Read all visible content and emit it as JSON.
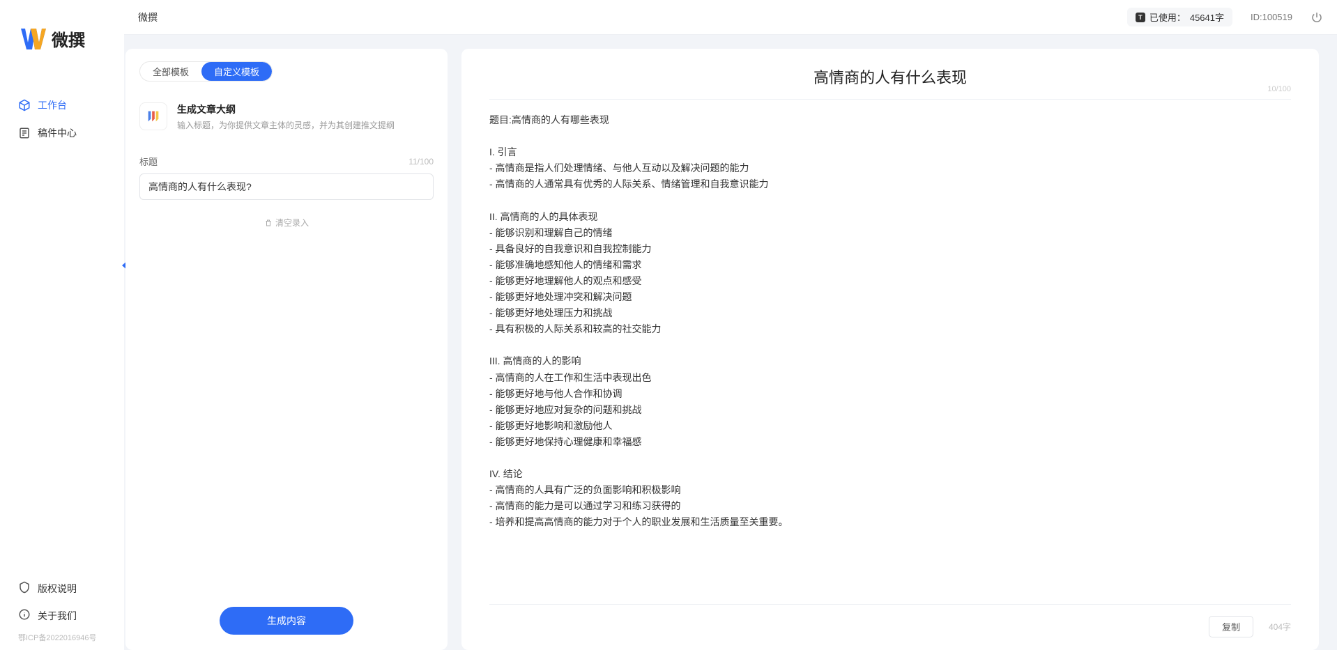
{
  "app": {
    "logo_text": "微撰",
    "title": "微撰"
  },
  "sidebar": {
    "nav": [
      {
        "label": "工作台",
        "active": true
      },
      {
        "label": "稿件中心",
        "active": false
      }
    ],
    "bottom": [
      {
        "label": "版权说明"
      },
      {
        "label": "关于我们"
      }
    ],
    "icp": "鄂ICP备2022016946号"
  },
  "topbar": {
    "usage_label": "已使用：",
    "usage_value": "45641字",
    "user_id": "ID:100519"
  },
  "left_panel": {
    "tabs": [
      {
        "label": "全部模板",
        "active": false
      },
      {
        "label": "自定义模板",
        "active": true
      }
    ],
    "template": {
      "name": "生成文章大纲",
      "desc": "输入标题，为你提供文章主体的灵感，并为其创建推文提纲"
    },
    "field": {
      "label": "标题",
      "count": "11/100",
      "value": "高情商的人有什么表现?"
    },
    "clear_link": "清空录入",
    "generate_btn": "生成内容"
  },
  "right_panel": {
    "title": "高情商的人有什么表现",
    "title_count": "10/100",
    "body": "题目:高情商的人有哪些表现\n\nI. 引言\n- 高情商是指人们处理情绪、与他人互动以及解决问题的能力\n- 高情商的人通常具有优秀的人际关系、情绪管理和自我意识能力\n\nII. 高情商的人的具体表现\n- 能够识别和理解自己的情绪\n- 具备良好的自我意识和自我控制能力\n- 能够准确地感知他人的情绪和需求\n- 能够更好地理解他人的观点和感受\n- 能够更好地处理冲突和解决问题\n- 能够更好地处理压力和挑战\n- 具有积极的人际关系和较高的社交能力\n\nIII. 高情商的人的影响\n- 高情商的人在工作和生活中表现出色\n- 能够更好地与他人合作和协调\n- 能够更好地应对复杂的问题和挑战\n- 能够更好地影响和激励他人\n- 能够更好地保持心理健康和幸福感\n\nIV. 结论\n- 高情商的人具有广泛的负面影响和积极影响\n- 高情商的能力是可以通过学习和练习获得的\n- 培养和提高高情商的能力对于个人的职业发展和生活质量至关重要。",
    "copy_btn": "复制",
    "char_count": "404字"
  }
}
